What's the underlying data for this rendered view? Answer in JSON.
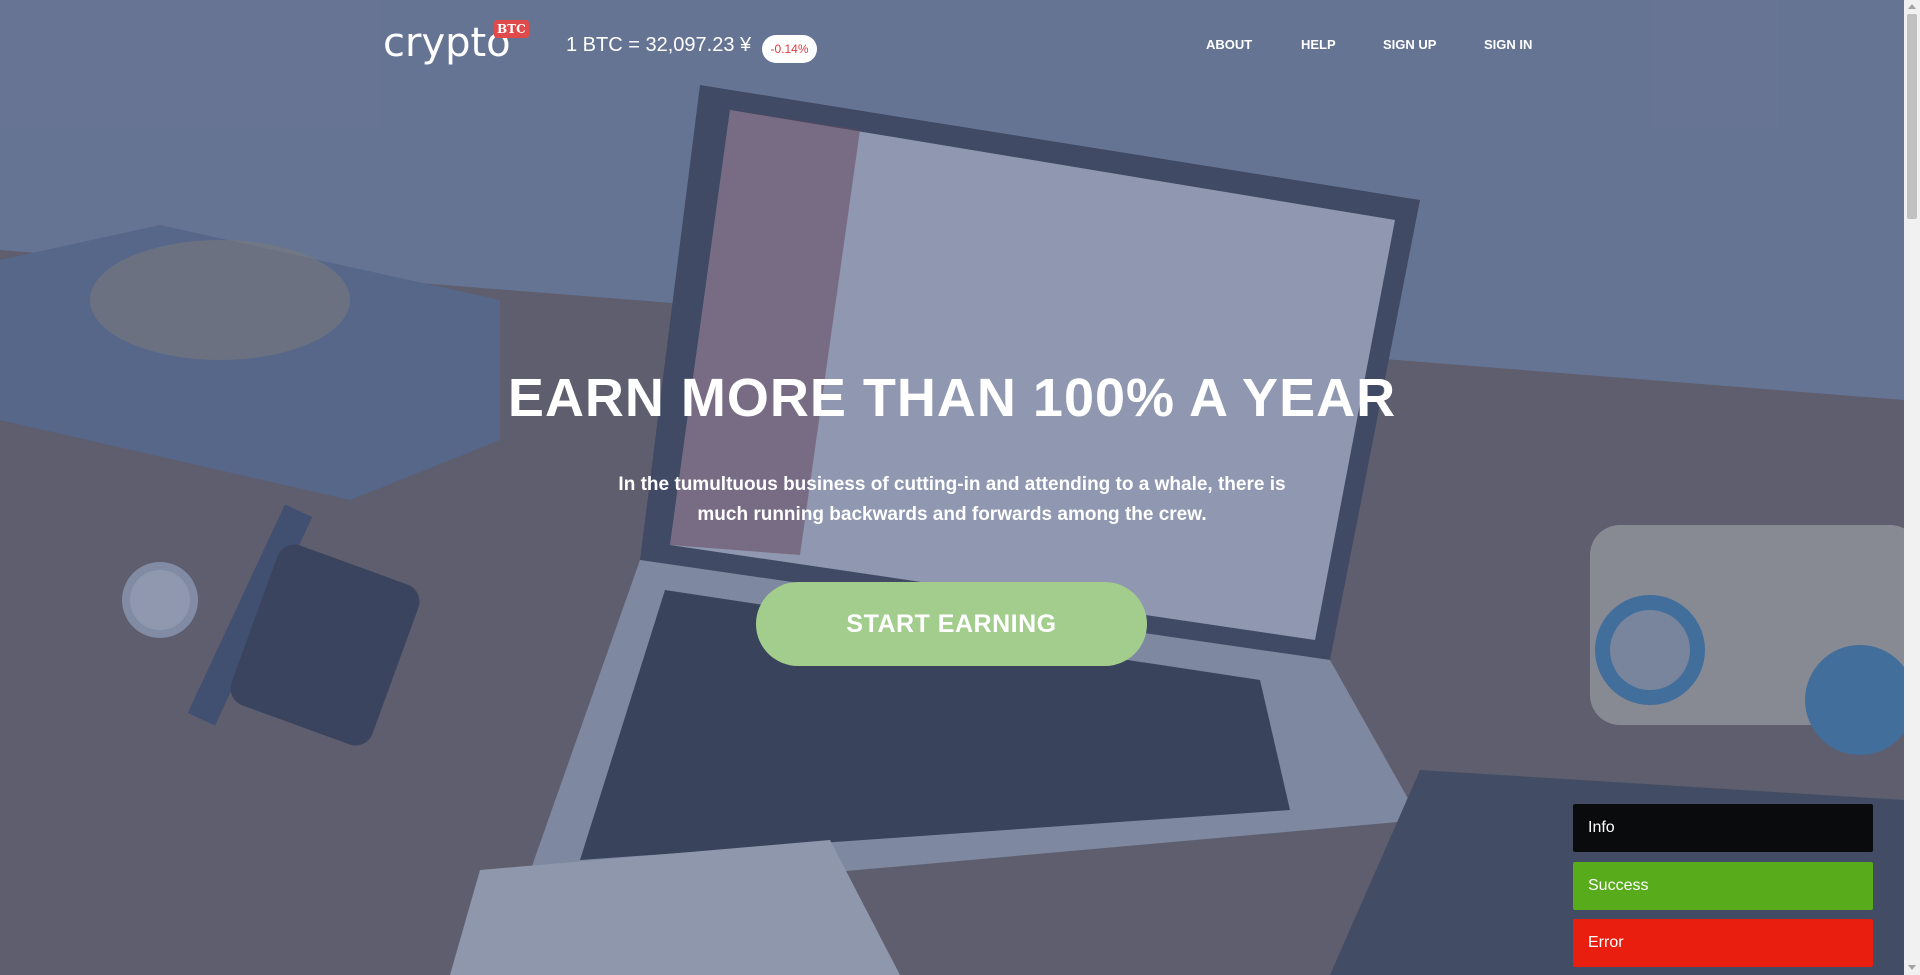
{
  "header": {
    "logo_text": "crypto",
    "logo_badge": "BTC",
    "rate": "1 BTC = 32,097.23 ¥",
    "change": "-0.14%",
    "nav": [
      "ABOUT",
      "HELP",
      "SIGN UP",
      "SIGN IN"
    ]
  },
  "hero": {
    "title": "EARN MORE THAN 100% A YEAR",
    "subtitle": "In the tumultuous business of cutting-in and attending to a whale, there is much running backwards and forwards among the crew.",
    "cta": "START EARNING"
  },
  "toasts": {
    "info": "Info",
    "success": "Success",
    "error": "Error"
  },
  "colors": {
    "overlay": "#465478",
    "cta": "#a3cd8c",
    "badge": "#e04a4a",
    "change_text": "#e03a3a",
    "toast_info": "#0a0b0d",
    "toast_success": "#58ac1c",
    "toast_error": "#ea1e0e"
  }
}
